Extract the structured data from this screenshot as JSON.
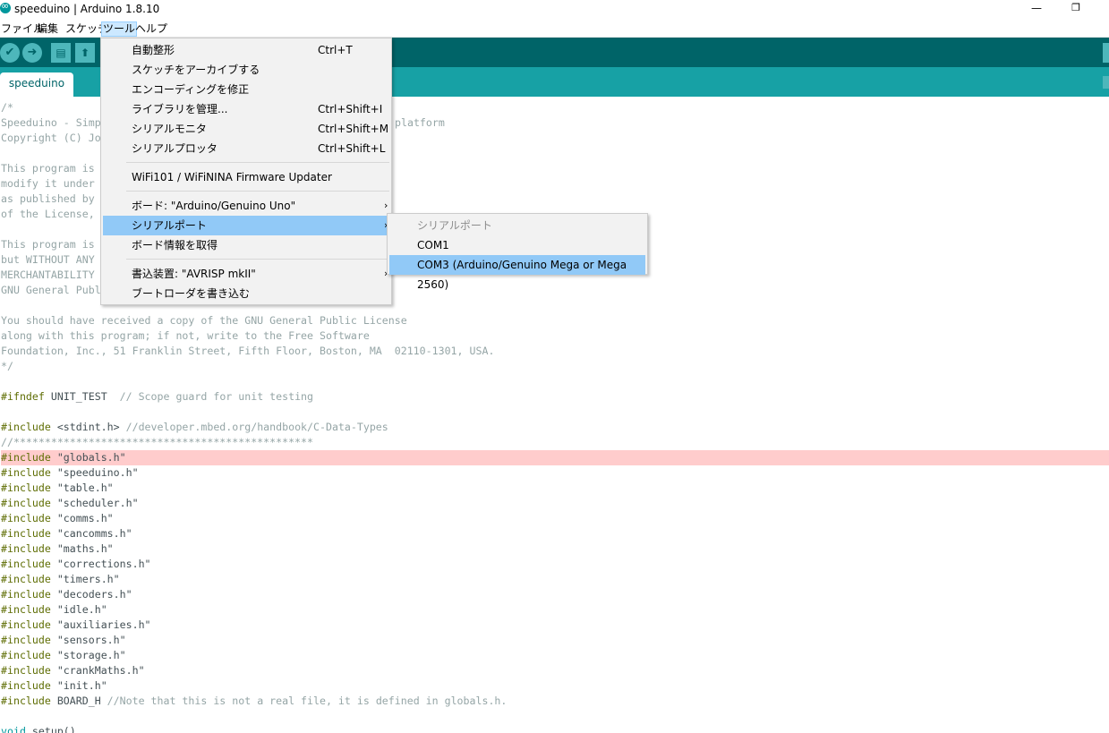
{
  "window": {
    "title": "speeduino | Arduino 1.8.10",
    "minimize_glyph": "—",
    "maximize_glyph": "❐"
  },
  "menubar": {
    "items": [
      "ファイル",
      "編集",
      "スケッチ",
      "ツール",
      "ヘルプ"
    ],
    "active": "ツール"
  },
  "toolbar": {
    "verify_icon": "checkmark-icon",
    "upload_icon": "arrow-right-icon",
    "new_icon": "new-file-icon",
    "open_icon": "open-arrow-up-icon",
    "verify_glyph": "✔",
    "upload_glyph": "➜",
    "new_glyph": "▤",
    "open_glyph": "⬆"
  },
  "tabs": [
    {
      "label": "speeduino"
    }
  ],
  "tools_menu": {
    "items": [
      {
        "label": "自動整形",
        "shortcut": "Ctrl+T"
      },
      {
        "label": "スケッチをアーカイブする",
        "shortcut": ""
      },
      {
        "label": "エンコーディングを修正",
        "shortcut": ""
      },
      {
        "label": "ライブラリを管理...",
        "shortcut": "Ctrl+Shift+I"
      },
      {
        "label": "シリアルモニタ",
        "shortcut": "Ctrl+Shift+M"
      },
      {
        "label": "シリアルプロッタ",
        "shortcut": "Ctrl+Shift+L"
      },
      {
        "label": "WiFi101 / WiFiNINA Firmware Updater",
        "shortcut": ""
      },
      {
        "label": "ボード: \"Arduino/Genuino Uno\"",
        "shortcut": ""
      },
      {
        "label": "シリアルポート",
        "shortcut": ""
      },
      {
        "label": "ボード情報を取得",
        "shortcut": ""
      },
      {
        "label": "書込装置: \"AVRISP mkII\"",
        "shortcut": ""
      },
      {
        "label": "ブートローダを書き込む",
        "shortcut": ""
      }
    ],
    "submenu_arrow": "›",
    "selected": "シリアルポート"
  },
  "port_menu": {
    "items": [
      {
        "label": "シリアルポート",
        "state": "disabled"
      },
      {
        "label": "COM1",
        "state": "normal"
      },
      {
        "label": "COM3 (Arduino/Genuino Mega or Mega 2560)",
        "state": "selected"
      }
    ]
  },
  "colors": {
    "toolbar": "#006468",
    "tabbar": "#17a1a5",
    "highlight_line": "#ffcccc",
    "menu_selected": "#91c9f7"
  },
  "code": {
    "l1": "/*",
    "l2a": "Speeduino - Simp",
    "l2b": "platform",
    "l3": "Copyright (C) Jo",
    "l5": "This program is",
    "l6": "modify it under",
    "l7": "as published by",
    "l8": "of the License,",
    "l10": "This program is",
    "l11": "but WITHOUT ANY",
    "l12": "MERCHANTABILITY",
    "l13": "GNU General Publ",
    "l15": "You should have received a copy of the GNU General Public License",
    "l16": "along with this program; if not, write to the Free Software",
    "l17": "Foundation, Inc., 51 Franklin Street, Fifth Floor, Boston, MA  02110-1301, USA.",
    "l18": "*/",
    "ifndef_kw": "#ifndef",
    "ifndef_rest": " UNIT_TEST  ",
    "ifndef_cm": "// Scope guard for unit testing",
    "stdint_kw": "#include",
    "stdint_rest": " <stdint.h> ",
    "stdint_cm": "//developer.mbed.org/handbook/C-Data-Types",
    "stars": "//************************************************",
    "include_kw": "#include",
    "includes": [
      "\"globals.h\"",
      "\"speeduino.h\"",
      "\"table.h\"",
      "\"scheduler.h\"",
      "\"comms.h\"",
      "\"cancomms.h\"",
      "\"maths.h\"",
      "\"corrections.h\"",
      "\"timers.h\"",
      "\"decoders.h\"",
      "\"idle.h\"",
      "\"auxiliaries.h\"",
      "\"sensors.h\"",
      "\"storage.h\"",
      "\"crankMaths.h\"",
      "\"init.h\""
    ],
    "board_rest": " BOARD_H ",
    "board_cm": "//Note that this is not a real file, it is defined in globals.h.",
    "void_kw": "void",
    "setup_rest": " setup()"
  }
}
